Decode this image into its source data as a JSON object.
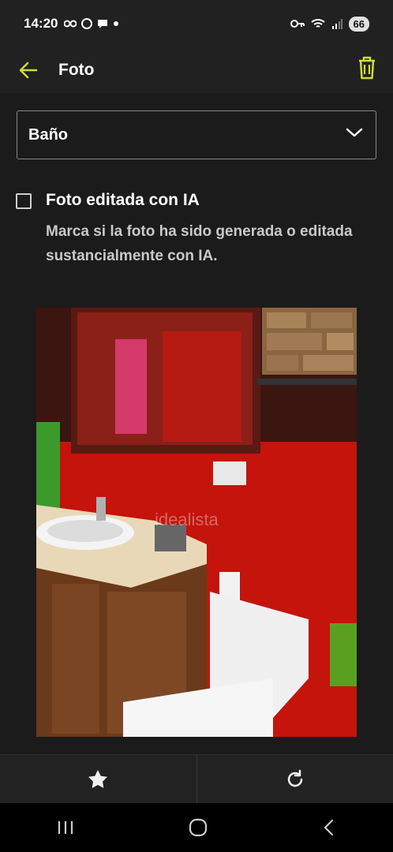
{
  "status_bar": {
    "time": "14:20",
    "battery": "66",
    "icons": [
      "link-icon",
      "whatsapp-icon",
      "chat-icon",
      "dot-icon",
      "key-icon",
      "wifi-icon",
      "signal-icon"
    ]
  },
  "app_bar": {
    "title": "Foto",
    "accent_color": "#cddc39"
  },
  "room_select": {
    "selected": "Baño"
  },
  "ai_checkbox": {
    "title": "Foto editada con IA",
    "description": "Marca si la foto ha sido generada o editada sustancialmente con IA.",
    "checked": false
  },
  "photo": {
    "watermark": "idealista"
  },
  "bottom_actions": [
    "star-icon",
    "rotate-icon"
  ]
}
